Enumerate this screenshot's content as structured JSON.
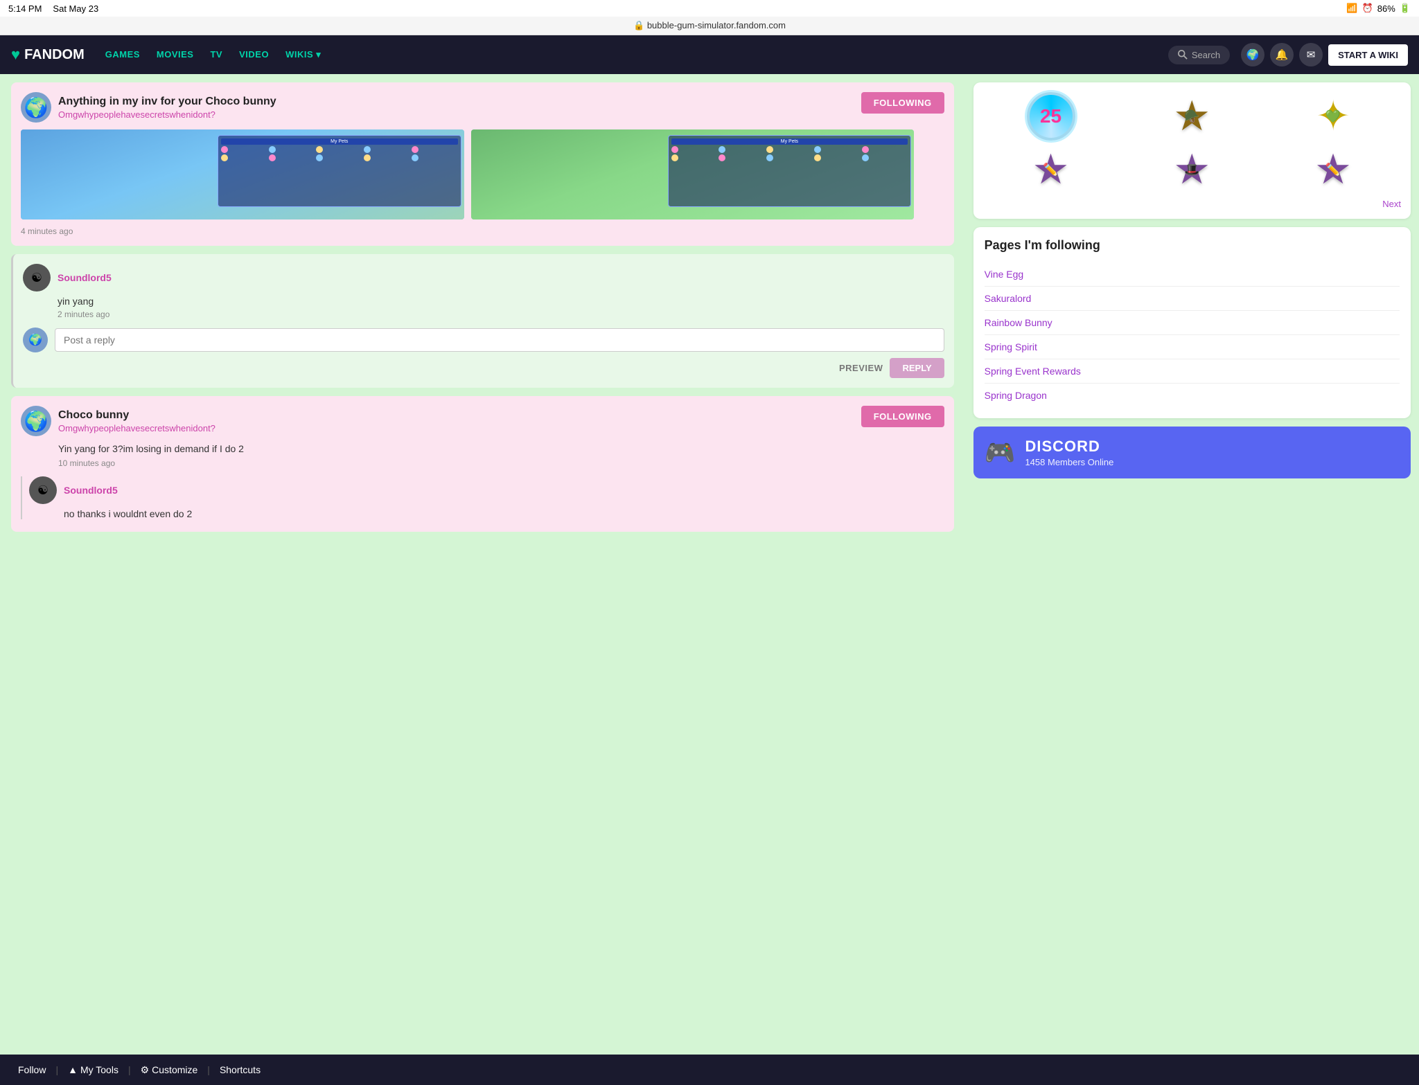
{
  "status_bar": {
    "time": "5:14 PM",
    "day": "Sat May 23",
    "battery": "86%"
  },
  "address_bar": {
    "url": "bubble-gum-simulator.fandom.com",
    "lock": "🔒"
  },
  "navbar": {
    "logo": "FANDOM",
    "logo_icon": "♥",
    "links": [
      {
        "label": "GAMES"
      },
      {
        "label": "MOVIES"
      },
      {
        "label": "TV"
      },
      {
        "label": "VIDEO"
      },
      {
        "label": "WIKIS ▾"
      }
    ],
    "search_placeholder": "Search",
    "start_wiki": "START A WIKI"
  },
  "posts": [
    {
      "title": "Anything in my inv for your Choco bunny",
      "username": "Omgwhypeoplehavesecretswhenidont?",
      "following_label": "FOLLOWING",
      "timestamp": "4 minutes ago",
      "avatar_emoji": "🌍"
    },
    {
      "title": "Choco bunny",
      "username": "Omgwhypeoplehavesecretswhenidont?",
      "following_label": "FOLLOWING",
      "body": "Yin yang for 3?im losing in demand if I do 2",
      "timestamp": "10 minutes ago",
      "avatar_emoji": "🌍"
    }
  ],
  "comment": {
    "username": "Soundlord5",
    "text": "yin yang",
    "timestamp": "2 minutes ago",
    "avatar_emoji": "☯"
  },
  "reply": {
    "placeholder": "Post a reply",
    "preview_label": "PREVIEW",
    "reply_label": "REPLY",
    "avatar_emoji": "🌍"
  },
  "nested_comment": {
    "username": "Soundlord5",
    "text": "no thanks i wouldnt even do 2",
    "avatar_emoji": "☯"
  },
  "sidebar": {
    "badges_next": "Next",
    "badge_25": "25",
    "pages_following": {
      "title": "Pages I'm following",
      "pages": [
        {
          "label": "Vine Egg"
        },
        {
          "label": "Sakuralord"
        },
        {
          "label": "Rainbow Bunny"
        },
        {
          "label": "Spring Spirit"
        },
        {
          "label": "Spring Event Rewards"
        },
        {
          "label": "Spring Dragon"
        }
      ]
    },
    "discord": {
      "title": "DISCORD",
      "members": "1458",
      "status": "Members Online"
    }
  },
  "bottom_bar": {
    "follow_label": "Follow",
    "my_tools_label": "My Tools",
    "customize_label": "Customize",
    "shortcuts_label": "Shortcuts"
  }
}
